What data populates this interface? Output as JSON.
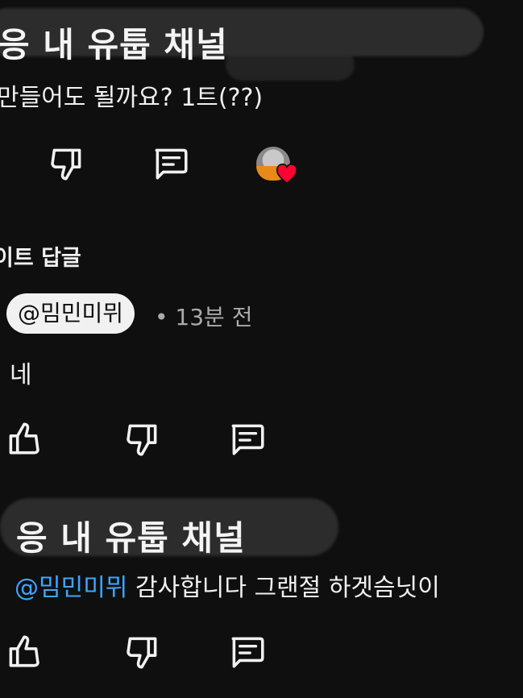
{
  "comment_top": {
    "title": "응 내 유툽 채널",
    "body": "만들어도 될까요? 1트(??)"
  },
  "replies_header": {
    "label": "이트 답글"
  },
  "reply": {
    "mention": "@밈민미뮈",
    "meta": "• 13분 전",
    "body": "네"
  },
  "comment_bottom": {
    "title": "응 내 유툽 채널",
    "mention": "@밈민미뮈",
    "body": " 감사합니다 그랜절 하겟슴닛이"
  },
  "icons": {
    "like": "thumbs-up-icon",
    "dislike": "thumbs-down-icon",
    "reply": "comment-icon",
    "heart": "heart-icon"
  },
  "colors": {
    "background": "#0f0f0f",
    "mention": "#3ea6ff",
    "heart": "#ff0033",
    "meta": "#aaaaaa"
  }
}
